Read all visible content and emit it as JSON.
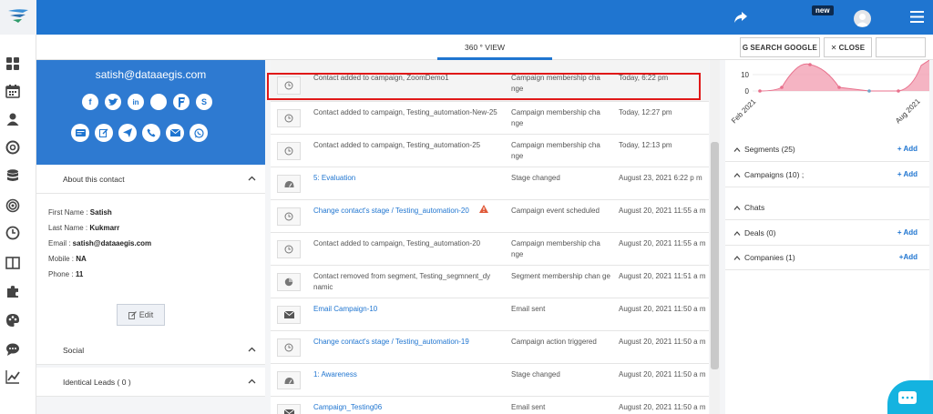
{
  "topbar": {
    "new_badge": "new"
  },
  "subbar": {
    "view_label": "360 ° VIEW",
    "search_google": "SEARCH GOOGLE",
    "close": "CLOSE"
  },
  "profile": {
    "email": "satish@dataaegis.com",
    "social_row1": [
      "f",
      "t",
      "in",
      "",
      "P",
      "S"
    ]
  },
  "about": {
    "title": "About this contact",
    "fields": [
      {
        "label": "First Name : ",
        "value": "Satish"
      },
      {
        "label": "Last Name : ",
        "value": "Kukmarr"
      },
      {
        "label": "Email : ",
        "value": "satish@dataaegis.com"
      },
      {
        "label": "Mobile : ",
        "value": "NA"
      },
      {
        "label": "Phone : ",
        "value": "11"
      }
    ],
    "edit_label": "Edit",
    "social_title": "Social",
    "identical_title": "Identical Leads ( 0 )"
  },
  "timeline": [
    {
      "icon": "clock",
      "desc": "Contact added to campaign, ZoomDemo1",
      "link": false,
      "type": "Campaign membership cha nge",
      "time": "Today, 6:22 pm"
    },
    {
      "icon": "clock",
      "desc": "Contact added to campaign, Testing_automation-New-25",
      "link": false,
      "type": "Campaign membership cha nge",
      "time": "Today, 12:27 pm"
    },
    {
      "icon": "clock",
      "desc": "Contact added to campaign, Testing_automation-25",
      "link": false,
      "type": "Campaign membership cha nge",
      "time": "Today, 12:13 pm"
    },
    {
      "icon": "gauge",
      "desc": "5: Evaluation",
      "link": true,
      "type": "Stage changed",
      "time": "August 23, 2021 6:22 p m"
    },
    {
      "icon": "clock",
      "desc": "Change contact's stage / Testing_automation-20",
      "link": true,
      "warn": true,
      "type": "Campaign event scheduled",
      "time": "August 20, 2021 11:55 a m"
    },
    {
      "icon": "clock",
      "desc": "Contact added to campaign, Testing_automation-20",
      "link": false,
      "type": "Campaign membership cha nge",
      "time": "August 20, 2021 11:55 a m"
    },
    {
      "icon": "pie",
      "desc": "Contact removed from segment, Testing_segmnent_dy namic",
      "link": false,
      "type": "Segment membership chan ge",
      "time": "August 20, 2021 11:51 a m"
    },
    {
      "icon": "mail",
      "desc": "Email Campaign-10",
      "link": true,
      "type": "Email sent",
      "time": "August 20, 2021 11:50 a m"
    },
    {
      "icon": "clock",
      "desc": "Change contact's stage / Testing_automation-19",
      "link": true,
      "type": "Campaign action triggered",
      "time": "August 20, 2021 11:50 a m"
    },
    {
      "icon": "gauge",
      "desc": "1: Awareness",
      "link": true,
      "type": "Stage changed",
      "time": "August 20, 2021 11:50 a m"
    },
    {
      "icon": "mail",
      "desc": "Campaign_Testing06",
      "link": true,
      "type": "Email sent",
      "time": "August 20, 2021 11:50 a m"
    }
  ],
  "mini_chart": {
    "y_ticks": [
      "10",
      "0"
    ],
    "x_labels": [
      "Feb 2021",
      "Aug 2021"
    ]
  },
  "right_sections": [
    {
      "title": "Segments (25)",
      "add": "+ Add"
    },
    {
      "title": "Campaigns (10) ;",
      "add": "+ Add"
    },
    {
      "title": "Chats",
      "add": ""
    },
    {
      "title": "Deals (0)",
      "add": "+ Add"
    },
    {
      "title": "Companies (1)",
      "add": "+Add"
    }
  ],
  "colors": {
    "brand_blue": "#1f75d0",
    "highlight_red": "#e01818",
    "chart_fill": "#f3a1b4",
    "chat_bubble": "#14b3e0"
  }
}
